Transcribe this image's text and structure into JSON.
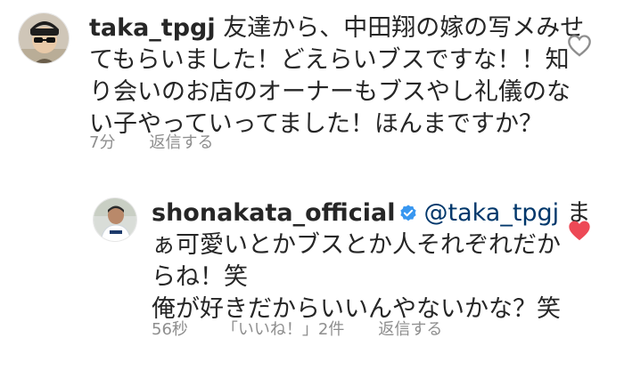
{
  "comments": [
    {
      "username": "taka_tpgj",
      "lines": [
        "友達から、中田翔の嫁の写メみせ",
        "てもらいました！どえらいブスですな！！知",
        "り会いのお店のオーナーもブスやし礼儀のな",
        "い子やっていってました！ほんまですか？"
      ],
      "time": "7分",
      "reply": "返信する",
      "liked": false
    },
    {
      "username": "shonakata_official",
      "verified": true,
      "mention": "@taka_tpgj",
      "lines": [
        "ま",
        "ぁ可愛いとかブスとか人それぞれだか",
        "らね！笑",
        "俺が好きだからいいんやないかな？笑"
      ],
      "time": "56秒",
      "likes": "「いいね！」2件",
      "reply": "返信する",
      "liked": true
    }
  ],
  "colors": {
    "text": "#262626",
    "meta": "#8e8e8e",
    "heart_liked": "#ed4956",
    "heart_outline": "#8e8e8e",
    "verified": "#3897f0"
  }
}
